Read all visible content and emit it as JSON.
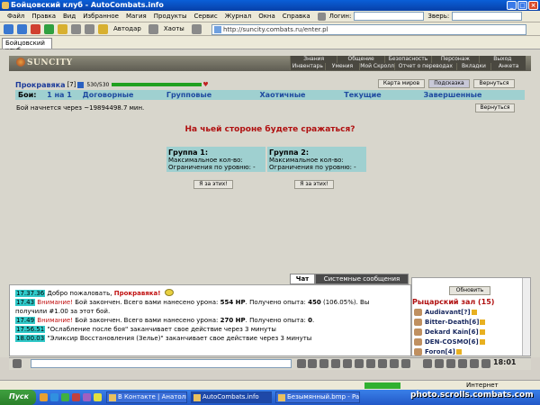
{
  "window": {
    "title": "Бойцовский клуб - AutoCombats.info"
  },
  "menu": {
    "items": [
      "Файл",
      "Правка",
      "Вид",
      "Избранное",
      "Магия",
      "Продукты",
      "Сервис",
      "Журнал",
      "Окна",
      "Справка"
    ],
    "login_label": "Логин:",
    "beast_label": "Зверь:"
  },
  "toolbar": {
    "autodar": "Автодар",
    "chaotic": "Хаоты"
  },
  "address": {
    "url": "http://suncity.combats.ru/enter.pl"
  },
  "tabs": {
    "active": "Бойцовский клуб"
  },
  "game": {
    "logo": "SUNCITY",
    "nav_top": [
      "Знания",
      "Общение",
      "Безопасность",
      "Персонаж",
      "Выход"
    ],
    "nav_bottom": [
      "Инвентарь",
      "Умения",
      "Мой Скролл",
      "Отчет о переводах",
      "Вкладки",
      "Анкета"
    ],
    "player": {
      "name": "Прокравяка",
      "level": "[7]",
      "hp": "530/530"
    },
    "buttons": {
      "map": "Карта миров",
      "hint": "Подсказка",
      "return": "Вернуться"
    },
    "fight_tabs": {
      "label": "Бои:",
      "items": [
        "1 на 1",
        "Договорные",
        "Групповые",
        "Хаотичные",
        "Текущие",
        "Завершенные"
      ]
    },
    "fight_status": "Бой начнется через ~19894498.7 мин.",
    "question": "На чьей стороне будете сражаться?",
    "group1": {
      "title": "Группа 1:",
      "max": "Максимальное кол-во:",
      "limit": "Ограничения по уровню: -"
    },
    "group2": {
      "title": "Группа 2:",
      "max": "Максимальное кол-во:",
      "limit": "Ограничения по уровню: -"
    },
    "join1": "Я за этих!",
    "join2": "Я за этих!"
  },
  "chat": {
    "tabs": [
      "Чат",
      "Системные сообщения"
    ],
    "lines": [
      {
        "time": "17.37.36",
        "pre": "Добро пожаловать, ",
        "name": "Прокравяка!"
      },
      {
        "time": "17.43",
        "warn": "Внимание!",
        "text": " Бой закончен. Всего вами нанесено урона: ",
        "dmg": "554 HP",
        "mid": ". Получено опыта: ",
        "exp": "450",
        "tail": " (106.05%). Вы"
      },
      {
        "text": "получили #1.00 за этот бой."
      },
      {
        "time": "17.49",
        "warn": "Внимание!",
        "text": " Бой закончен. Всего вами нанесено урона: ",
        "dmg": "270 HP",
        "mid": ". Получено опыта: ",
        "exp": "0",
        "tail": "."
      },
      {
        "time": "17.56.51",
        "text": " \"Ослабление после боя\" заканчивает свое действие через 3 минуты"
      },
      {
        "time": "18.00.03",
        "text": " \"Эликсир Восстановления (Зелье)\" заканчивает свое действие через 3 минуты"
      }
    ]
  },
  "rightpanel": {
    "refresh": "Обновить",
    "hall": "Рыцарский зал (15)",
    "users": [
      "Audiavant[?]",
      "Bitter-Death[6]",
      "Dekard Kain[6]",
      "DEN-COSMO[6]",
      "Foron[4]"
    ]
  },
  "clock": "18:01",
  "statusbar": {
    "zone": "Интернет"
  },
  "taskbar": {
    "start": "Пуск",
    "items": [
      "В Контакте | Анатолий ...",
      "AutoCombats.info",
      "Безымянный.bmp - Paint"
    ]
  },
  "watermark": "photo.scrolls.combats.com"
}
